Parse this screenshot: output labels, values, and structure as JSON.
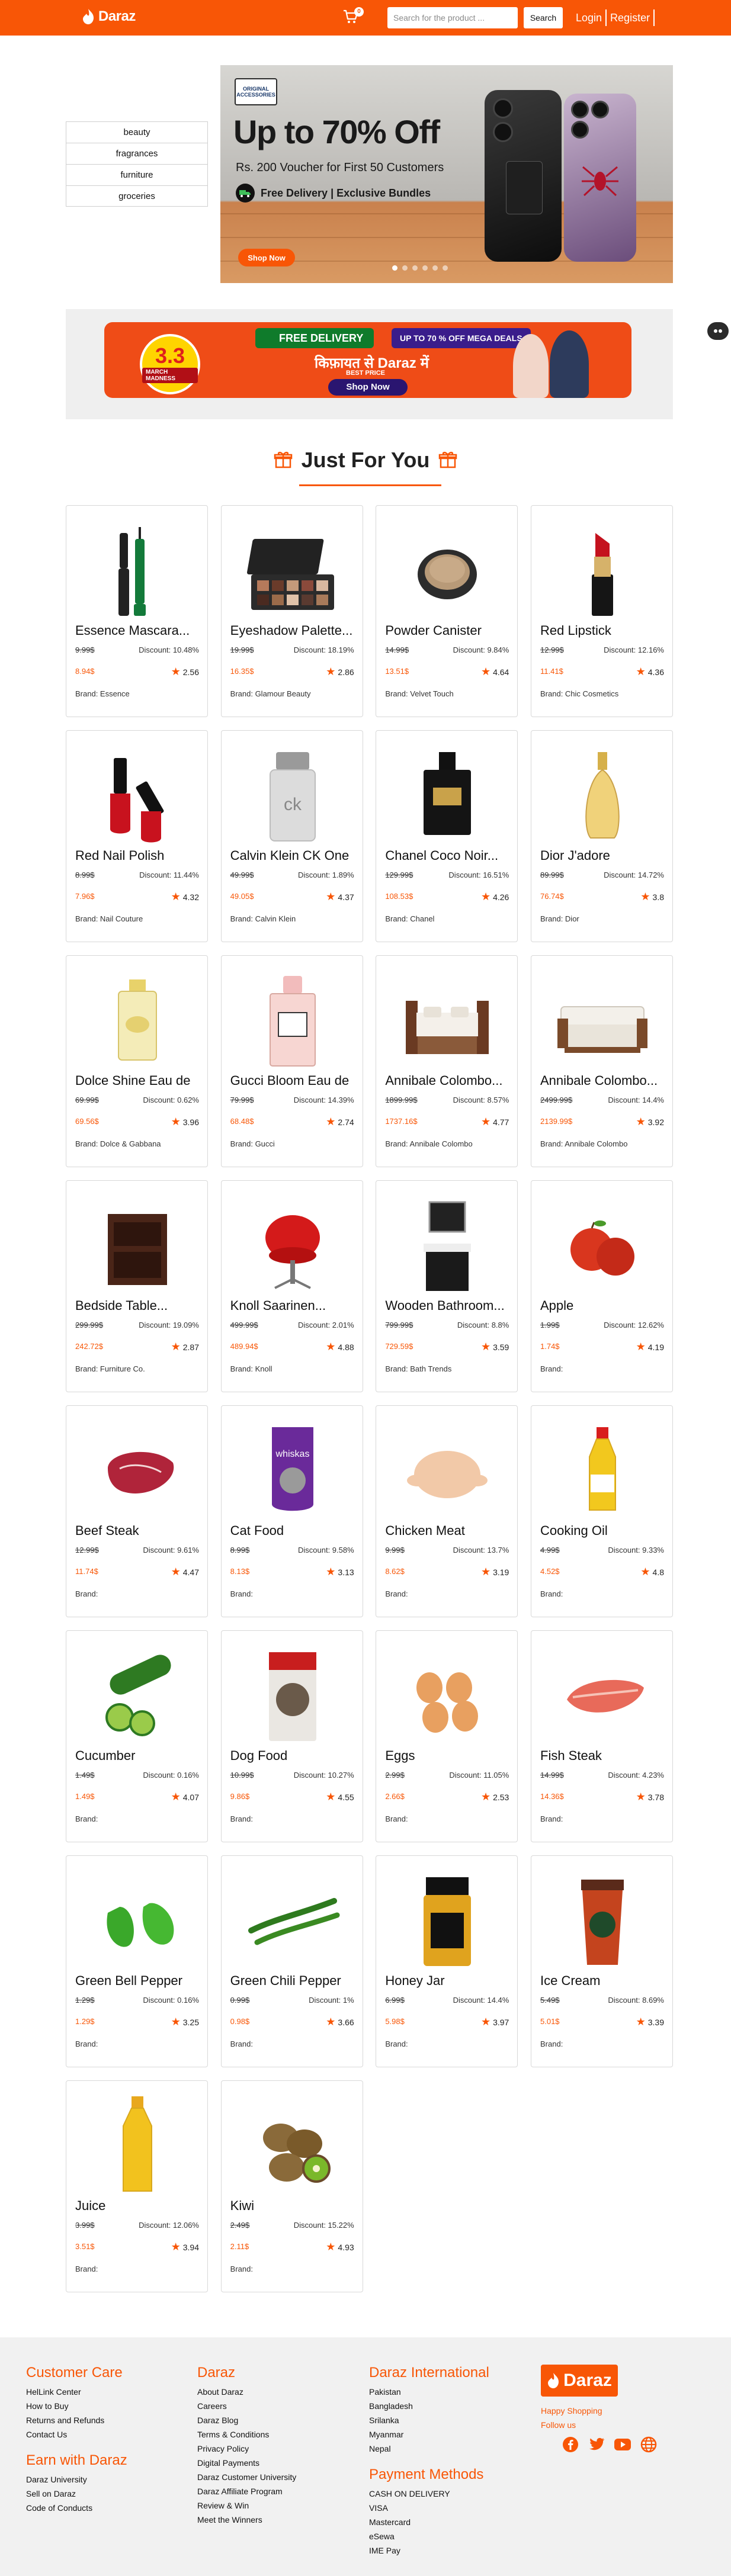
{
  "header": {
    "brand": "Daraz",
    "cart_count": "0",
    "search_placeholder": "Search for the product ...",
    "search_label": "Search",
    "login_label": "Login",
    "register_label": "Register",
    "accent": "#f85606"
  },
  "categories": [
    "beauty",
    "fragrances",
    "furniture",
    "groceries"
  ],
  "banner": {
    "brand_text": "ORIGINAL ACCESSORIES",
    "headline": "Up to 70% Off",
    "subline": "Rs. 200 Voucher for First 50 Customers",
    "delivery": "Free Delivery | Exclusive Bundles",
    "cta": "Shop Now"
  },
  "promo": {
    "sale_big": "3.3",
    "sale_small": "MARCH MADNESS",
    "free_delivery": "FREE DELIVERY",
    "deals": "UP TO 70 % OFF MEGA DEALS",
    "hindi_line": "किफ़ायत से Daraz में",
    "best_price": "BEST PRICE",
    "cta": "Shop Now"
  },
  "section": {
    "title": "Just For You"
  },
  "products": [
    {
      "name": "Essence Mascara...",
      "old": "9.99$",
      "discount": "Discount: 10.48%",
      "price": "8.94$",
      "rating": "2.56",
      "brand": "Brand: Essence",
      "icon": "mascara"
    },
    {
      "name": "Eyeshadow Palette...",
      "old": "19.99$",
      "discount": "Discount: 18.19%",
      "price": "16.35$",
      "rating": "2.86",
      "brand": "Brand: Glamour Beauty",
      "icon": "palette"
    },
    {
      "name": "Powder Canister",
      "old": "14.99$",
      "discount": "Discount: 9.84%",
      "price": "13.51$",
      "rating": "4.64",
      "brand": "Brand: Velvet Touch",
      "icon": "powder"
    },
    {
      "name": "Red Lipstick",
      "old": "12.99$",
      "discount": "Discount: 12.16%",
      "price": "11.41$",
      "rating": "4.36",
      "brand": "Brand: Chic Cosmetics",
      "icon": "lipstick"
    },
    {
      "name": "Red Nail Polish",
      "old": "8.99$",
      "discount": "Discount: 11.44%",
      "price": "7.96$",
      "rating": "4.32",
      "brand": "Brand: Nail Couture",
      "icon": "nailpolish"
    },
    {
      "name": "Calvin Klein CK One",
      "old": "49.99$",
      "discount": "Discount: 1.89%",
      "price": "49.05$",
      "rating": "4.37",
      "brand": "Brand: Calvin Klein",
      "icon": "ck"
    },
    {
      "name": "Chanel Coco Noir...",
      "old": "129.99$",
      "discount": "Discount: 16.51%",
      "price": "108.53$",
      "rating": "4.26",
      "brand": "Brand: Chanel",
      "icon": "chanel"
    },
    {
      "name": "Dior J'adore",
      "old": "89.99$",
      "discount": "Discount: 14.72%",
      "price": "76.74$",
      "rating": "3.8",
      "brand": "Brand: Dior",
      "icon": "dior"
    },
    {
      "name": "Dolce Shine Eau de",
      "old": "69.99$",
      "discount": "Discount: 0.62%",
      "price": "69.56$",
      "rating": "3.96",
      "brand": "Brand: Dolce & Gabbana",
      "icon": "dolce"
    },
    {
      "name": "Gucci Bloom Eau de",
      "old": "79.99$",
      "discount": "Discount: 14.39%",
      "price": "68.48$",
      "rating": "2.74",
      "brand": "Brand: Gucci",
      "icon": "gucci"
    },
    {
      "name": "Annibale Colombo...",
      "old": "1899.99$",
      "discount": "Discount: 8.57%",
      "price": "1737.16$",
      "rating": "4.77",
      "brand": "Brand: Annibale Colombo",
      "icon": "bed"
    },
    {
      "name": "Annibale Colombo...",
      "old": "2499.99$",
      "discount": "Discount: 14.4%",
      "price": "2139.99$",
      "rating": "3.92",
      "brand": "Brand: Annibale Colombo",
      "icon": "sofa"
    },
    {
      "name": "Bedside Table...",
      "old": "299.99$",
      "discount": "Discount: 19.09%",
      "price": "242.72$",
      "rating": "2.87",
      "brand": "Brand: Furniture Co.",
      "icon": "bedside"
    },
    {
      "name": "Knoll Saarinen...",
      "old": "499.99$",
      "discount": "Discount: 2.01%",
      "price": "489.94$",
      "rating": "4.88",
      "brand": "Brand: Knoll",
      "icon": "chair"
    },
    {
      "name": "Wooden Bathroom...",
      "old": "799.99$",
      "discount": "Discount: 8.8%",
      "price": "729.59$",
      "rating": "3.59",
      "brand": "Brand: Bath Trends",
      "icon": "sink"
    },
    {
      "name": "Apple",
      "old": "1.99$",
      "discount": "Discount: 12.62%",
      "price": "1.74$",
      "rating": "4.19",
      "brand": "Brand:",
      "icon": "apple"
    },
    {
      "name": "Beef Steak",
      "old": "12.99$",
      "discount": "Discount: 9.61%",
      "price": "11.74$",
      "rating": "4.47",
      "brand": "Brand:",
      "icon": "beef"
    },
    {
      "name": "Cat Food",
      "old": "8.99$",
      "discount": "Discount: 9.58%",
      "price": "8.13$",
      "rating": "3.13",
      "brand": "Brand:",
      "icon": "catfood"
    },
    {
      "name": "Chicken Meat",
      "old": "9.99$",
      "discount": "Discount: 13.7%",
      "price": "8.62$",
      "rating": "3.19",
      "brand": "Brand:",
      "icon": "chicken"
    },
    {
      "name": "Cooking Oil",
      "old": "4.99$",
      "discount": "Discount: 9.33%",
      "price": "4.52$",
      "rating": "4.8",
      "brand": "Brand:",
      "icon": "oil"
    },
    {
      "name": "Cucumber",
      "old": "1.49$",
      "discount": "Discount: 0.16%",
      "price": "1.49$",
      "rating": "4.07",
      "brand": "Brand:",
      "icon": "cucumber"
    },
    {
      "name": "Dog Food",
      "old": "10.99$",
      "discount": "Discount: 10.27%",
      "price": "9.86$",
      "rating": "4.55",
      "brand": "Brand:",
      "icon": "dogfood"
    },
    {
      "name": "Eggs",
      "old": "2.99$",
      "discount": "Discount: 11.05%",
      "price": "2.66$",
      "rating": "2.53",
      "brand": "Brand:",
      "icon": "eggs"
    },
    {
      "name": "Fish Steak",
      "old": "14.99$",
      "discount": "Discount: 4.23%",
      "price": "14.36$",
      "rating": "3.78",
      "brand": "Brand:",
      "icon": "fish"
    },
    {
      "name": "Green Bell Pepper",
      "old": "1.29$",
      "discount": "Discount: 0.16%",
      "price": "1.29$",
      "rating": "3.25",
      "brand": "Brand:",
      "icon": "bellpepper"
    },
    {
      "name": "Green Chili Pepper",
      "old": "0.99$",
      "discount": "Discount: 1%",
      "price": "0.98$",
      "rating": "3.66",
      "brand": "Brand:",
      "icon": "chili"
    },
    {
      "name": "Honey Jar",
      "old": "6.99$",
      "discount": "Discount: 14.4%",
      "price": "5.98$",
      "rating": "3.97",
      "brand": "Brand:",
      "icon": "honey"
    },
    {
      "name": "Ice Cream",
      "old": "5.49$",
      "discount": "Discount: 8.69%",
      "price": "5.01$",
      "rating": "3.39",
      "brand": "Brand:",
      "icon": "icecream"
    },
    {
      "name": "Juice",
      "old": "3.99$",
      "discount": "Discount: 12.06%",
      "price": "3.51$",
      "rating": "3.94",
      "brand": "Brand:",
      "icon": "juice"
    },
    {
      "name": "Kiwi",
      "old": "2.49$",
      "discount": "Discount: 15.22%",
      "price": "2.11$",
      "rating": "4.93",
      "brand": "Brand:",
      "icon": "kiwi"
    }
  ],
  "footer": {
    "customer_care": {
      "title": "Customer Care",
      "links": [
        "HelLink Center",
        "How to Buy",
        "Returns and Refunds",
        "Contact Us"
      ]
    },
    "earn": {
      "title": "Earn with Daraz",
      "links": [
        "Daraz University",
        "Sell on Daraz",
        "Code of Conducts"
      ]
    },
    "daraz": {
      "title": "Daraz",
      "links": [
        "About Daraz",
        "Careers",
        "Daraz Blog",
        "Terms & Conditions",
        "Privacy Policy",
        "Digital Payments",
        "Daraz Customer University",
        "Daraz Affiliate Program",
        "Review & Win",
        "Meet the Winners"
      ]
    },
    "international": {
      "title": "Daraz International",
      "links": [
        "Pakistan",
        "Bangladesh",
        "Srilanka",
        "Myanmar",
        "Nepal"
      ]
    },
    "payment": {
      "title": "Payment Methods",
      "links": [
        "CASH ON DELIVERY",
        "VISA",
        "Mastercard",
        "eSewa",
        "IME Pay"
      ]
    },
    "brand": "Daraz",
    "tagline_1": "Happy Shopping",
    "tagline_2": "Follow us"
  }
}
